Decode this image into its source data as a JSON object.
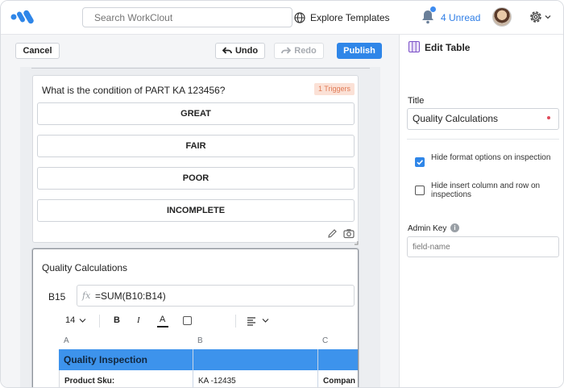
{
  "header": {
    "search_placeholder": "Search WorkClout",
    "explore_label": "Explore Templates",
    "unread_label": "4 Unread"
  },
  "toolbar": {
    "cancel_label": "Cancel",
    "undo_label": "Undo",
    "redo_label": "Redo",
    "publish_label": "Publish"
  },
  "question": {
    "text": "What is the condition of PART KA 123456?",
    "triggers_badge": "1 Triggers",
    "options": [
      "GREAT",
      "FAIR",
      "POOR",
      "INCOMPLETE"
    ]
  },
  "table_block": {
    "title": "Quality Calculations",
    "cell_ref": "B15",
    "fx_symbol": "fx",
    "formula": "=SUM(B10:B14)",
    "font_size": "14",
    "bold_label": "B",
    "italic_label": "I",
    "color_label": "A",
    "columns": [
      "A",
      "B",
      "C"
    ],
    "rows": [
      [
        "Quality Inspection",
        "",
        ""
      ],
      [
        "Product Sku:",
        "KA -12435",
        "Compan"
      ]
    ],
    "highlight_color": "#3d93ec"
  },
  "panel": {
    "title": "Edit Table",
    "title_label": "Title",
    "title_value": "Quality Calculations",
    "options": [
      {
        "label": "Hide format options on inspection",
        "checked": true
      },
      {
        "label": "Hide insert column and row on inspections",
        "checked": false
      }
    ],
    "admin_key_label": "Admin Key",
    "info_glyph": "i",
    "admin_key_placeholder": "field-name"
  },
  "colors": {
    "accent": "#2f86e8",
    "trigger_bg": "#fbe1d6",
    "trigger_text": "#e07a55"
  }
}
